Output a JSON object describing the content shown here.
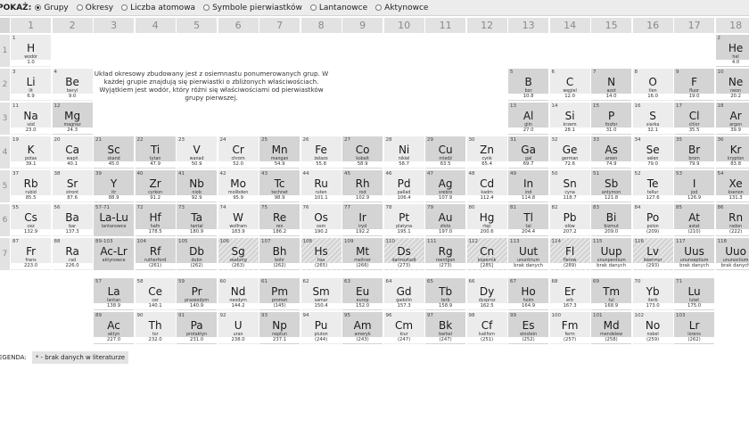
{
  "show_label": "POKAŻ:",
  "view_options": [
    {
      "label": "Grupy",
      "selected": true
    },
    {
      "label": "Okresy",
      "selected": false
    },
    {
      "label": "Liczba atomowa",
      "selected": false
    },
    {
      "label": "Symbole pierwiastków",
      "selected": false
    },
    {
      "label": "Lantanowce",
      "selected": false
    },
    {
      "label": "Aktynowce",
      "selected": false
    }
  ],
  "groups": [
    "1",
    "2",
    "3",
    "4",
    "5",
    "6",
    "7",
    "8",
    "9",
    "10",
    "11",
    "12",
    "13",
    "14",
    "15",
    "16",
    "17",
    "18"
  ],
  "periods": [
    "1",
    "2",
    "3",
    "4",
    "5",
    "6",
    "7"
  ],
  "description": "Układ okresowy zbudowany jest z osiemnastu ponumerowanych grup. W każdej grupie znajdują się pierwiastki o zbliżonych właściwościach. Wyjątkiem jest wodór, który różni się właściwościami od pierwiastków grupy pierwszej.",
  "legend": {
    "label": "EGENDA:",
    "item": "* - brak danych w literaturze"
  },
  "elements": [
    {
      "n": "1",
      "s": "H",
      "name": "wodór",
      "m": "1.0",
      "g": 1,
      "p": 1
    },
    {
      "n": "2",
      "s": "He",
      "name": "hel",
      "m": "4.0",
      "g": 18,
      "p": 1
    },
    {
      "n": "3",
      "s": "Li",
      "name": "lit",
      "m": "6.9",
      "g": 1,
      "p": 2
    },
    {
      "n": "4",
      "s": "Be",
      "name": "beryl",
      "m": "9.0",
      "g": 2,
      "p": 2
    },
    {
      "n": "5",
      "s": "B",
      "name": "bor",
      "m": "10.8",
      "g": 13,
      "p": 2
    },
    {
      "n": "6",
      "s": "C",
      "name": "węgiel",
      "m": "12.0",
      "g": 14,
      "p": 2
    },
    {
      "n": "7",
      "s": "N",
      "name": "azot",
      "m": "14.0",
      "g": 15,
      "p": 2
    },
    {
      "n": "8",
      "s": "O",
      "name": "tlen",
      "m": "16.0",
      "g": 16,
      "p": 2
    },
    {
      "n": "9",
      "s": "F",
      "name": "fluor",
      "m": "19.0",
      "g": 17,
      "p": 2
    },
    {
      "n": "10",
      "s": "Ne",
      "name": "neon",
      "m": "20.2",
      "g": 18,
      "p": 2
    },
    {
      "n": "11",
      "s": "Na",
      "name": "sód",
      "m": "23.0",
      "g": 1,
      "p": 3
    },
    {
      "n": "12",
      "s": "Mg",
      "name": "magnez",
      "m": "24.3",
      "g": 2,
      "p": 3
    },
    {
      "n": "13",
      "s": "Al",
      "name": "glin",
      "m": "27.0",
      "g": 13,
      "p": 3
    },
    {
      "n": "14",
      "s": "Si",
      "name": "krzem",
      "m": "28.1",
      "g": 14,
      "p": 3
    },
    {
      "n": "15",
      "s": "P",
      "name": "fosfor",
      "m": "31.0",
      "g": 15,
      "p": 3
    },
    {
      "n": "16",
      "s": "S",
      "name": "siarka",
      "m": "32.1",
      "g": 16,
      "p": 3
    },
    {
      "n": "17",
      "s": "Cl",
      "name": "chlor",
      "m": "35.5",
      "g": 17,
      "p": 3
    },
    {
      "n": "18",
      "s": "Ar",
      "name": "argon",
      "m": "39.9",
      "g": 18,
      "p": 3
    },
    {
      "n": "19",
      "s": "K",
      "name": "potas",
      "m": "39.1",
      "g": 1,
      "p": 4
    },
    {
      "n": "20",
      "s": "Ca",
      "name": "wapń",
      "m": "40.1",
      "g": 2,
      "p": 4
    },
    {
      "n": "21",
      "s": "Sc",
      "name": "skand",
      "m": "45.0",
      "g": 3,
      "p": 4
    },
    {
      "n": "22",
      "s": "Ti",
      "name": "tytan",
      "m": "47.9",
      "g": 4,
      "p": 4
    },
    {
      "n": "23",
      "s": "V",
      "name": "wanad",
      "m": "50.9",
      "g": 5,
      "p": 4
    },
    {
      "n": "24",
      "s": "Cr",
      "name": "chrom",
      "m": "52.0",
      "g": 6,
      "p": 4
    },
    {
      "n": "25",
      "s": "Mn",
      "name": "mangan",
      "m": "54.9",
      "g": 7,
      "p": 4
    },
    {
      "n": "26",
      "s": "Fe",
      "name": "żelazo",
      "m": "55.8",
      "g": 8,
      "p": 4
    },
    {
      "n": "27",
      "s": "Co",
      "name": "kobalt",
      "m": "58.9",
      "g": 9,
      "p": 4
    },
    {
      "n": "28",
      "s": "Ni",
      "name": "nikiel",
      "m": "58.7",
      "g": 10,
      "p": 4
    },
    {
      "n": "29",
      "s": "Cu",
      "name": "miedź",
      "m": "63.5",
      "g": 11,
      "p": 4
    },
    {
      "n": "30",
      "s": "Zn",
      "name": "cynk",
      "m": "65.4",
      "g": 12,
      "p": 4
    },
    {
      "n": "31",
      "s": "Ga",
      "name": "gal",
      "m": "69.7",
      "g": 13,
      "p": 4
    },
    {
      "n": "32",
      "s": "Ge",
      "name": "german",
      "m": "72.6",
      "g": 14,
      "p": 4
    },
    {
      "n": "33",
      "s": "As",
      "name": "arsen",
      "m": "74.9",
      "g": 15,
      "p": 4
    },
    {
      "n": "34",
      "s": "Se",
      "name": "selen",
      "m": "79.0",
      "g": 16,
      "p": 4
    },
    {
      "n": "35",
      "s": "Br",
      "name": "brom",
      "m": "79.9",
      "g": 17,
      "p": 4
    },
    {
      "n": "36",
      "s": "Kr",
      "name": "krypton",
      "m": "83.8",
      "g": 18,
      "p": 4
    },
    {
      "n": "37",
      "s": "Rb",
      "name": "rubid",
      "m": "85.5",
      "g": 1,
      "p": 5
    },
    {
      "n": "38",
      "s": "Sr",
      "name": "stront",
      "m": "87.6",
      "g": 2,
      "p": 5
    },
    {
      "n": "39",
      "s": "Y",
      "name": "itr",
      "m": "88.9",
      "g": 3,
      "p": 5
    },
    {
      "n": "40",
      "s": "Zr",
      "name": "cyrkon",
      "m": "91.2",
      "g": 4,
      "p": 5
    },
    {
      "n": "41",
      "s": "Nb",
      "name": "niob",
      "m": "92.9",
      "g": 5,
      "p": 5
    },
    {
      "n": "42",
      "s": "Mo",
      "name": "molibden",
      "m": "95.9",
      "g": 6,
      "p": 5
    },
    {
      "n": "43",
      "s": "Tc",
      "name": "technet",
      "m": "98.9",
      "g": 7,
      "p": 5
    },
    {
      "n": "44",
      "s": "Ru",
      "name": "ruten",
      "m": "101.1",
      "g": 8,
      "p": 5
    },
    {
      "n": "45",
      "s": "Rh",
      "name": "rod",
      "m": "102.9",
      "g": 9,
      "p": 5
    },
    {
      "n": "46",
      "s": "Pd",
      "name": "pallad",
      "m": "106.4",
      "g": 10,
      "p": 5
    },
    {
      "n": "47",
      "s": "Ag",
      "name": "srebro",
      "m": "107.9",
      "g": 11,
      "p": 5
    },
    {
      "n": "48",
      "s": "Cd",
      "name": "kadm",
      "m": "112.4",
      "g": 12,
      "p": 5
    },
    {
      "n": "49",
      "s": "In",
      "name": "ind",
      "m": "114.8",
      "g": 13,
      "p": 5
    },
    {
      "n": "50",
      "s": "Sn",
      "name": "cyna",
      "m": "118.7",
      "g": 14,
      "p": 5
    },
    {
      "n": "51",
      "s": "Sb",
      "name": "antymon",
      "m": "121.8",
      "g": 15,
      "p": 5
    },
    {
      "n": "52",
      "s": "Te",
      "name": "tellur",
      "m": "127.6",
      "g": 16,
      "p": 5
    },
    {
      "n": "53",
      "s": "I",
      "name": "jod",
      "m": "126.9",
      "g": 17,
      "p": 5
    },
    {
      "n": "54",
      "s": "Xe",
      "name": "ksenon",
      "m": "131.3",
      "g": 18,
      "p": 5
    },
    {
      "n": "55",
      "s": "Cs",
      "name": "cez",
      "m": "132.9",
      "g": 1,
      "p": 6
    },
    {
      "n": "56",
      "s": "Ba",
      "name": "bar",
      "m": "137.3",
      "g": 2,
      "p": 6
    },
    {
      "n": "57-71",
      "s": "La-Lu",
      "name": "lantanowce",
      "m": "",
      "g": 3,
      "p": 6
    },
    {
      "n": "72",
      "s": "Hf",
      "name": "hafn",
      "m": "178.5",
      "g": 4,
      "p": 6
    },
    {
      "n": "73",
      "s": "Ta",
      "name": "tantal",
      "m": "180.9",
      "g": 5,
      "p": 6
    },
    {
      "n": "74",
      "s": "W",
      "name": "wolfram",
      "m": "183.9",
      "g": 6,
      "p": 6
    },
    {
      "n": "75",
      "s": "Re",
      "name": "ren",
      "m": "186.2",
      "g": 7,
      "p": 6
    },
    {
      "n": "76",
      "s": "Os",
      "name": "osm",
      "m": "190.2",
      "g": 8,
      "p": 6
    },
    {
      "n": "77",
      "s": "Ir",
      "name": "iryd",
      "m": "192.2",
      "g": 9,
      "p": 6
    },
    {
      "n": "78",
      "s": "Pt",
      "name": "platyna",
      "m": "195.1",
      "g": 10,
      "p": 6
    },
    {
      "n": "79",
      "s": "Au",
      "name": "złoto",
      "m": "197.0",
      "g": 11,
      "p": 6
    },
    {
      "n": "80",
      "s": "Hg",
      "name": "rtęć",
      "m": "200.6",
      "g": 12,
      "p": 6
    },
    {
      "n": "81",
      "s": "Tl",
      "name": "tal",
      "m": "204.4",
      "g": 13,
      "p": 6
    },
    {
      "n": "82",
      "s": "Pb",
      "name": "ołów",
      "m": "207.2",
      "g": 14,
      "p": 6
    },
    {
      "n": "83",
      "s": "Bi",
      "name": "bizmut",
      "m": "209.0",
      "g": 15,
      "p": 6
    },
    {
      "n": "84",
      "s": "Po",
      "name": "polon",
      "m": "(209)",
      "g": 16,
      "p": 6
    },
    {
      "n": "85",
      "s": "At",
      "name": "astat",
      "m": "(210)",
      "g": 17,
      "p": 6
    },
    {
      "n": "86",
      "s": "Rn",
      "name": "radon",
      "m": "(222)",
      "g": 18,
      "p": 6
    },
    {
      "n": "87",
      "s": "Fr",
      "name": "frans",
      "m": "223.0",
      "g": 1,
      "p": 7
    },
    {
      "n": "88",
      "s": "Ra",
      "name": "rad",
      "m": "226.0",
      "g": 2,
      "p": 7
    },
    {
      "n": "89-103",
      "s": "Ac-Lr",
      "name": "aktynowce",
      "m": "",
      "g": 3,
      "p": 7
    },
    {
      "n": "104",
      "s": "Rf",
      "name": "rutherford",
      "m": "(261)",
      "g": 4,
      "p": 7
    },
    {
      "n": "105",
      "s": "Db",
      "name": "dubn",
      "m": "(262)",
      "g": 5,
      "p": 7
    },
    {
      "n": "106",
      "s": "Sg",
      "name": "seaborg",
      "m": "(263)",
      "g": 6,
      "p": 7
    },
    {
      "n": "107",
      "s": "Bh",
      "name": "bohr",
      "m": "(262)",
      "g": 7,
      "p": 7
    },
    {
      "n": "108",
      "s": "Hs",
      "name": "has",
      "m": "(265)",
      "g": 8,
      "p": 7
    },
    {
      "n": "109",
      "s": "Mt",
      "name": "meitner",
      "m": "(266)",
      "g": 9,
      "p": 7
    },
    {
      "n": "110",
      "s": "Ds",
      "name": "darmsztadt",
      "m": "(273)",
      "g": 10,
      "p": 7
    },
    {
      "n": "111",
      "s": "Rg",
      "name": "roentgen",
      "m": "(273)",
      "g": 11,
      "p": 7
    },
    {
      "n": "112",
      "s": "Cn",
      "name": "kopernik",
      "m": "[285]",
      "g": 12,
      "p": 7
    },
    {
      "n": "113",
      "s": "Uut",
      "name": "ununtrium",
      "m": "brak danych",
      "g": 13,
      "p": 7
    },
    {
      "n": "114",
      "s": "Fl",
      "name": "flerow",
      "m": "(289)",
      "g": 14,
      "p": 7
    },
    {
      "n": "115",
      "s": "Uup",
      "name": "ununpentium",
      "m": "brak danych",
      "g": 15,
      "p": 7
    },
    {
      "n": "116",
      "s": "Lv",
      "name": "liwermor",
      "m": "(293)",
      "g": 16,
      "p": 7
    },
    {
      "n": "117",
      "s": "Uus",
      "name": "ununseptium",
      "m": "brak danych",
      "g": 17,
      "p": 7
    },
    {
      "n": "118",
      "s": "Uuo",
      "name": "ununoctium",
      "m": "brak danych",
      "g": 18,
      "p": 7
    },
    {
      "n": "57",
      "s": "La",
      "name": "lantan",
      "m": "138.9",
      "g": 3,
      "p": 8
    },
    {
      "n": "58",
      "s": "Ce",
      "name": "cer",
      "m": "140.1",
      "g": 4,
      "p": 8
    },
    {
      "n": "59",
      "s": "Pr",
      "name": "prazeodym",
      "m": "140.9",
      "g": 5,
      "p": 8
    },
    {
      "n": "60",
      "s": "Nd",
      "name": "neodym",
      "m": "144.2",
      "g": 6,
      "p": 8
    },
    {
      "n": "61",
      "s": "Pm",
      "name": "promet",
      "m": "(145)",
      "g": 7,
      "p": 8
    },
    {
      "n": "62",
      "s": "Sm",
      "name": "samar",
      "m": "150.4",
      "g": 8,
      "p": 8
    },
    {
      "n": "63",
      "s": "Eu",
      "name": "europ",
      "m": "152.0",
      "g": 9,
      "p": 8
    },
    {
      "n": "64",
      "s": "Gd",
      "name": "gadolin",
      "m": "157.3",
      "g": 10,
      "p": 8
    },
    {
      "n": "65",
      "s": "Tb",
      "name": "terb",
      "m": "158.9",
      "g": 11,
      "p": 8
    },
    {
      "n": "66",
      "s": "Dy",
      "name": "dysproz",
      "m": "162.5",
      "g": 12,
      "p": 8
    },
    {
      "n": "67",
      "s": "Ho",
      "name": "holm",
      "m": "164.9",
      "g": 13,
      "p": 8
    },
    {
      "n": "68",
      "s": "Er",
      "name": "erb",
      "m": "167.3",
      "g": 14,
      "p": 8
    },
    {
      "n": "69",
      "s": "Tm",
      "name": "tul",
      "m": "168.9",
      "g": 15,
      "p": 8
    },
    {
      "n": "70",
      "s": "Yb",
      "name": "iterb",
      "m": "173.0",
      "g": 16,
      "p": 8
    },
    {
      "n": "71",
      "s": "Lu",
      "name": "lutet",
      "m": "175.0",
      "g": 17,
      "p": 8
    },
    {
      "n": "89",
      "s": "Ac",
      "name": "aktyn",
      "m": "227.0",
      "g": 3,
      "p": 9
    },
    {
      "n": "90",
      "s": "Th",
      "name": "tor",
      "m": "232.0",
      "g": 4,
      "p": 9
    },
    {
      "n": "91",
      "s": "Pa",
      "name": "protaktyn",
      "m": "231.0",
      "g": 5,
      "p": 9
    },
    {
      "n": "92",
      "s": "U",
      "name": "uran",
      "m": "238.0",
      "g": 6,
      "p": 9
    },
    {
      "n": "93",
      "s": "Np",
      "name": "neptun",
      "m": "237.1",
      "g": 7,
      "p": 9
    },
    {
      "n": "94",
      "s": "Pu",
      "name": "pluton",
      "m": "(244)",
      "g": 8,
      "p": 9
    },
    {
      "n": "95",
      "s": "Am",
      "name": "ameryk",
      "m": "(243)",
      "g": 9,
      "p": 9
    },
    {
      "n": "96",
      "s": "Cm",
      "name": "kiur",
      "m": "(247)",
      "g": 10,
      "p": 9
    },
    {
      "n": "97",
      "s": "Bk",
      "name": "berkel",
      "m": "(247)",
      "g": 11,
      "p": 9
    },
    {
      "n": "98",
      "s": "Cf",
      "name": "kaliforn",
      "m": "(251)",
      "g": 12,
      "p": 9
    },
    {
      "n": "99",
      "s": "Es",
      "name": "einstein",
      "m": "(252)",
      "g": 13,
      "p": 9
    },
    {
      "n": "100",
      "s": "Fm",
      "name": "ferm",
      "m": "(257)",
      "g": 14,
      "p": 9
    },
    {
      "n": "101",
      "s": "Md",
      "name": "mendelew",
      "m": "(258)",
      "g": 15,
      "p": 9
    },
    {
      "n": "102",
      "s": "No",
      "name": "nobel",
      "m": "(259)",
      "g": 16,
      "p": 9
    },
    {
      "n": "103",
      "s": "Lr",
      "name": "lorens",
      "m": "(262)",
      "g": 17,
      "p": 9
    }
  ]
}
